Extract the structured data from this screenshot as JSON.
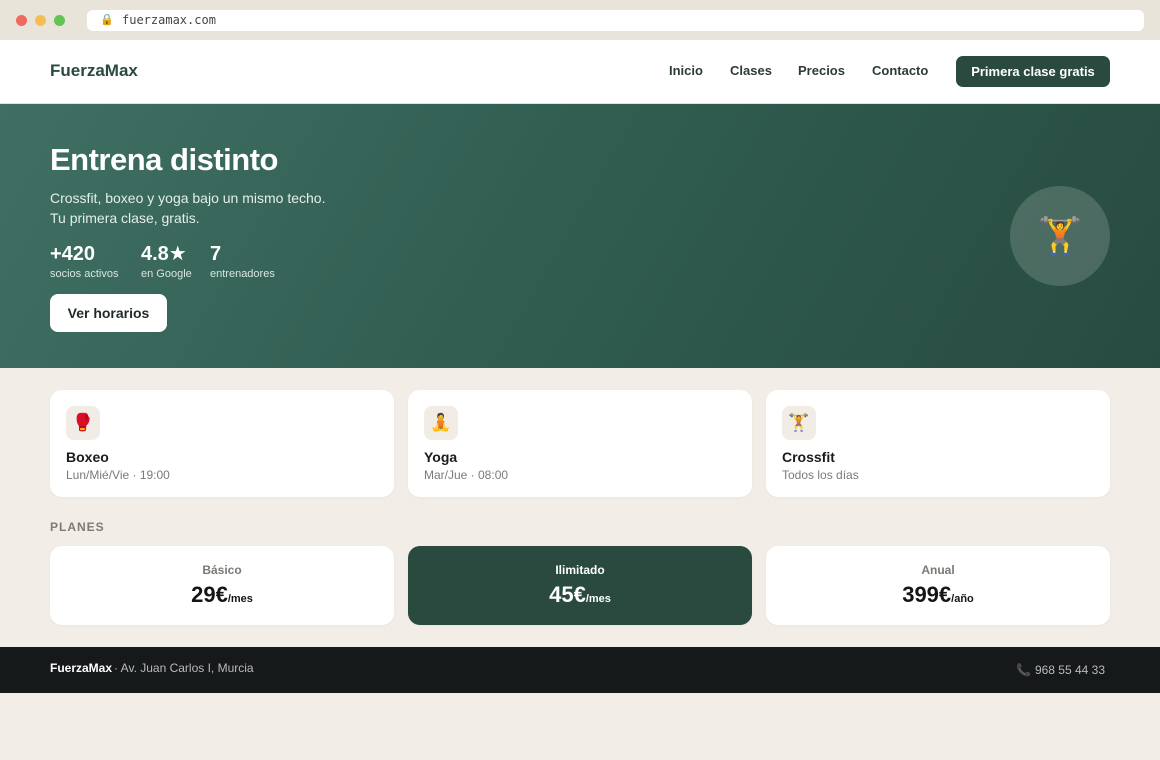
{
  "browser": {
    "url": "fuerzamax.com",
    "lock_icon": "lock-icon"
  },
  "nav": {
    "brand": "FuerzaMax",
    "links": [
      "Inicio",
      "Clases",
      "Precios",
      "Contacto"
    ],
    "cta": "Primera clase gratis"
  },
  "hero": {
    "title": "Entrena distinto",
    "subtitle_line1": "Crossfit, boxeo y yoga bajo un mismo techo.",
    "subtitle_line2": "Tu primera clase, gratis.",
    "stats": [
      {
        "value": "+420",
        "label": "socios activos"
      },
      {
        "value": "4.8★",
        "label": "en Google"
      },
      {
        "value": "7",
        "label": "entrenadores"
      }
    ],
    "button": "Ver horarios",
    "emoji": "🏋️"
  },
  "classes": [
    {
      "icon": "🥊",
      "name": "Boxeo",
      "schedule": "Lun/Mié/Vie · 19:00"
    },
    {
      "icon": "🧘",
      "name": "Yoga",
      "schedule": "Mar/Jue · 08:00"
    },
    {
      "icon": "🏋️",
      "name": "Crossfit",
      "schedule": "Todos los días"
    }
  ],
  "plans": {
    "label": "PLANES",
    "items": [
      {
        "name": "Básico",
        "price": "29€",
        "period": "/mes"
      },
      {
        "name": "Ilimitado",
        "price": "45€",
        "period": "/mes"
      },
      {
        "name": "Anual",
        "price": "399€",
        "period": "/año"
      }
    ]
  },
  "footer": {
    "brand": "FuerzaMax",
    "address": "· Av. Juan Carlos I, Murcia",
    "phone": "968 55 44 33"
  },
  "colors": {
    "brand_green": "#2a4a40",
    "background": "#f2eee7",
    "footer_bg": "#16191a"
  }
}
